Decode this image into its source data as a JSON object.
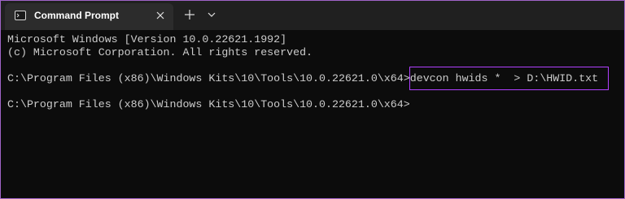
{
  "window": {
    "tab_title": "Command Prompt"
  },
  "icons": {
    "tab_icon": "terminal-icon",
    "close": "close-icon",
    "new_tab": "plus-icon",
    "dropdown": "chevron-down-icon"
  },
  "colors": {
    "terminal_bg": "#0c0c0c",
    "terminal_text": "#cccccc",
    "highlight_border": "#b040ff",
    "tabbar_bg": "#202020",
    "active_tab_bg": "#2c2c2c"
  },
  "terminal": {
    "header_line1": "Microsoft Windows [Version 10.0.22621.1992]",
    "header_line2": "(c) Microsoft Corporation. All rights reserved.",
    "prompt1": "C:\\Program Files (x86)\\Windows Kits\\10\\Tools\\10.0.22621.0\\x64>",
    "command1": "devcon hwids *  > D:\\HWID.txt",
    "prompt2": "C:\\Program Files (x86)\\Windows Kits\\10\\Tools\\10.0.22621.0\\x64>"
  }
}
